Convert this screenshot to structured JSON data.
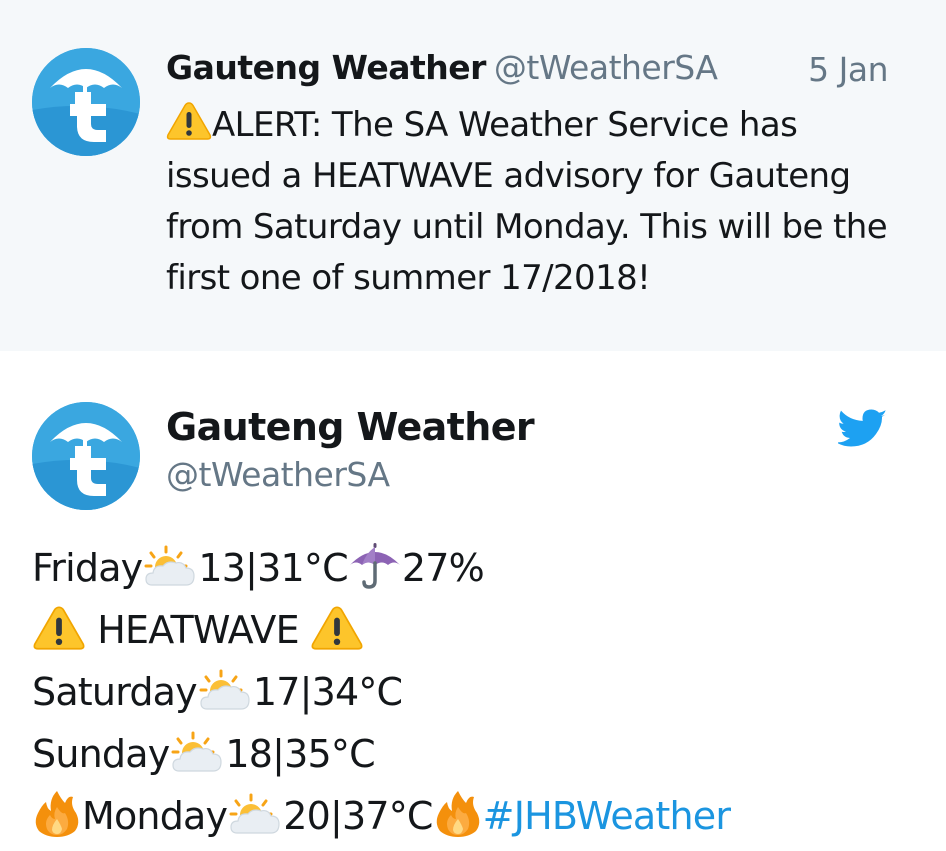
{
  "quoted_tweet": {
    "name": "Gauteng Weather",
    "handle": "@tWeatherSA",
    "date": "5 Jan",
    "text": "ALERT: The SA Weather Service has issued a HEATWAVE advisory for Gauteng from Saturday until Monday. This will be the first one of summer 17/2018!",
    "icons": [
      "warning-icon"
    ]
  },
  "tweet": {
    "name": "Gauteng Weather",
    "handle": "@tWeatherSA",
    "icons": [
      "avatar-umbrella-logo",
      "twitter-bird-icon"
    ],
    "lines": {
      "friday_day": "Friday",
      "friday_temp": "13|31°C",
      "friday_rain": "27%",
      "heatwave": "HEATWAVE",
      "saturday_day": "Saturday",
      "saturday_temp": "17|34°C",
      "sunday_day": "Sunday",
      "sunday_temp": "18|35°C",
      "monday_day": "Monday",
      "monday_temp": "20|37°C",
      "hashtag": "#JHBWeather"
    },
    "emoji_icons": [
      "sun-behind-cloud-icon",
      "umbrella-icon",
      "warning-icon",
      "fire-icon"
    ]
  },
  "colors": {
    "quoted_background": "#f5f8fa",
    "name": "#14171a",
    "secondary": "#657786",
    "link": "#1b95e0",
    "avatar": "#3aa7e0"
  }
}
